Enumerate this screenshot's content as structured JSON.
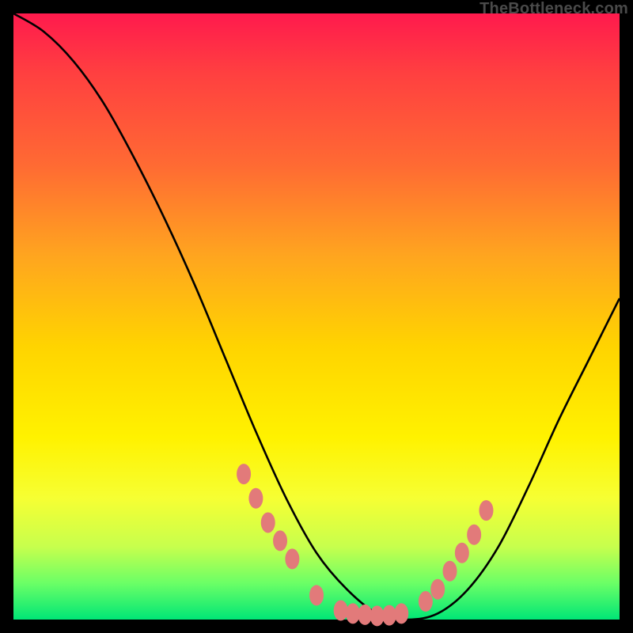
{
  "attribution": "TheBottleneck.com",
  "chart_data": {
    "type": "line",
    "title": "",
    "xlabel": "",
    "ylabel": "",
    "xlim": [
      0,
      100
    ],
    "ylim": [
      0,
      100
    ],
    "series": [
      {
        "name": "bottleneck-curve",
        "x": [
          0,
          5,
          10,
          15,
          20,
          25,
          30,
          35,
          40,
          45,
          50,
          55,
          60,
          65,
          70,
          75,
          80,
          85,
          90,
          95,
          100
        ],
        "values": [
          100,
          97,
          92,
          85,
          76,
          66,
          55,
          43,
          31,
          20,
          11,
          5,
          1,
          0,
          1,
          5,
          12,
          22,
          33,
          43,
          53
        ]
      }
    ],
    "markers": {
      "name": "highlighted-points",
      "color": "#e27a7a",
      "x": [
        38,
        40,
        42,
        44,
        46,
        50,
        54,
        56,
        58,
        60,
        62,
        64,
        68,
        70,
        72,
        74,
        76,
        78
      ],
      "values": [
        24,
        20,
        16,
        13,
        10,
        4,
        1.5,
        1,
        0.8,
        0.6,
        0.7,
        1,
        3,
        5,
        8,
        11,
        14,
        18
      ]
    }
  }
}
